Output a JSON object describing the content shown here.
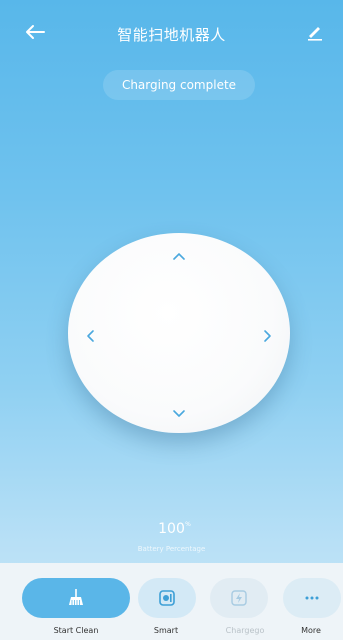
{
  "header": {
    "title": "智能扫地机器人",
    "back_icon": "back-arrow-icon",
    "edit_icon": "edit-pencil-icon"
  },
  "status": {
    "text": "Charging complete"
  },
  "dpad": {
    "up_icon": "chevron-up-icon",
    "down_icon": "chevron-down-icon",
    "left_icon": "chevron-left-icon",
    "right_icon": "chevron-right-icon"
  },
  "battery": {
    "value": "100",
    "unit": "%",
    "label": "Battery Percentage"
  },
  "actions": [
    {
      "label": "Start Clean",
      "icon": "broom-icon",
      "enabled": true
    },
    {
      "label": "Smart",
      "icon": "smart-mode-icon",
      "enabled": true
    },
    {
      "label": "Chargego",
      "icon": "charge-bolt-icon",
      "enabled": false
    },
    {
      "label": "More",
      "icon": "more-dots-icon",
      "enabled": true
    }
  ],
  "colors": {
    "accent": "#5ab6e8",
    "background_top": "#58b7ea",
    "background_bottom": "#c9e7f8",
    "disabled": "#b9c2c8"
  }
}
